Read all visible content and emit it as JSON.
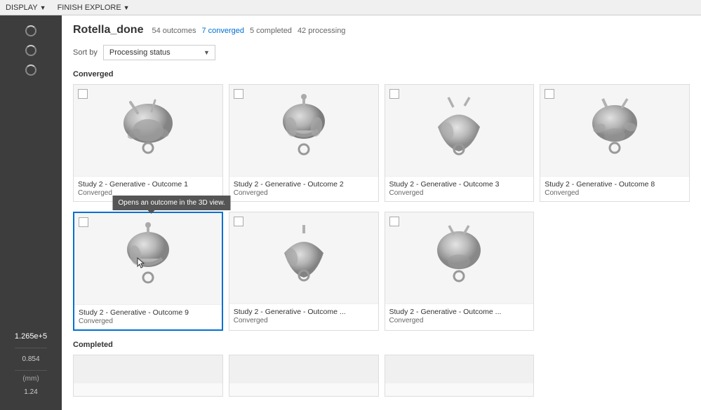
{
  "topbar": {
    "display_label": "DISPLAY",
    "finish_explore_label": "FINISH EXPLORE",
    "arrow": "▼"
  },
  "project": {
    "title": "Rotella_done",
    "stats": {
      "outcomes": "54 outcomes",
      "converged": "7 converged",
      "completed": "5 completed",
      "processing": "42 processing"
    }
  },
  "sort": {
    "label": "Sort by",
    "value": "Processing status"
  },
  "sections": {
    "converged_label": "Converged",
    "completed_label": "Completed"
  },
  "tooltip": {
    "text": "Opens an outcome in the 3D view."
  },
  "converged_cards": [
    {
      "title": "Study 2 - Generative - Outcome 1",
      "status": "Converged",
      "selected": false
    },
    {
      "title": "Study 2 - Generative - Outcome 2",
      "status": "Converged",
      "selected": false
    },
    {
      "title": "Study 2 - Generative - Outcome 3",
      "status": "Converged",
      "selected": false
    },
    {
      "title": "Study 2 - Generative - Outcome 8",
      "status": "Converged",
      "selected": false
    },
    {
      "title": "Study 2 - Generative - Outcome 9",
      "status": "Converged",
      "selected": true,
      "show_tooltip": true
    },
    {
      "title": "Study 2 - Generative - Outcome ...",
      "status": "Converged",
      "selected": false
    },
    {
      "title": "Study 2 - Generative - Outcome ...",
      "status": "Converged",
      "selected": false
    }
  ],
  "sidebar": {
    "spinners": 3,
    "value_main": "1.265e+5",
    "value_sub": "0.854",
    "unit": "(mm)",
    "unit_val": "1.24"
  }
}
